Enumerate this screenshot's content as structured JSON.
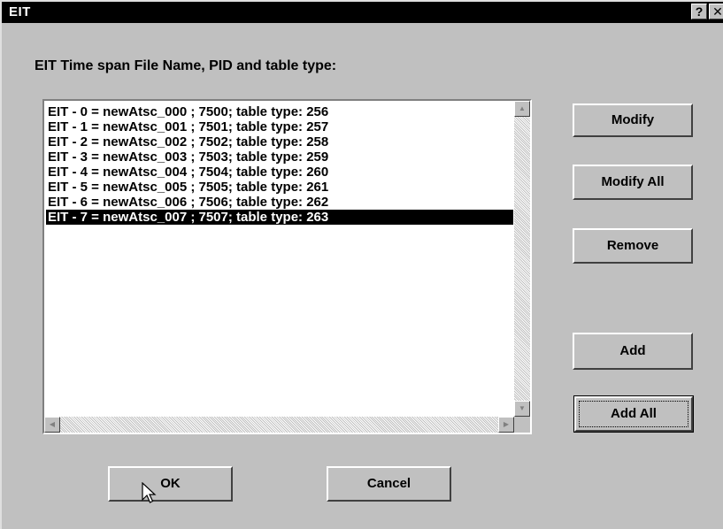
{
  "window": {
    "title": "EIT",
    "help_label": "?",
    "close_label": "✕"
  },
  "prompt": "EIT Time span File Name, PID and table type:",
  "list": {
    "items": [
      "EIT - 0 = newAtsc_000 ; 7500; table type: 256",
      "EIT - 1 = newAtsc_001 ; 7501; table type: 257",
      "EIT - 2 = newAtsc_002 ; 7502; table type: 258",
      "EIT - 3 = newAtsc_003 ; 7503; table type: 259",
      "EIT - 4 = newAtsc_004 ; 7504; table type: 260",
      "EIT - 5 = newAtsc_005 ; 7505; table type: 261",
      "EIT - 6 = newAtsc_006 ; 7506; table type: 262",
      "EIT - 7 = newAtsc_007 ; 7507; table type: 263"
    ],
    "selected_index": 7
  },
  "buttons": {
    "modify": "Modify",
    "modify_all": "Modify All",
    "remove": "Remove",
    "add": "Add",
    "add_all": "Add All",
    "ok": "OK",
    "cancel": "Cancel"
  },
  "scroll_arrows": {
    "up": "▲",
    "down": "▼",
    "left": "◀",
    "right": "▶"
  }
}
